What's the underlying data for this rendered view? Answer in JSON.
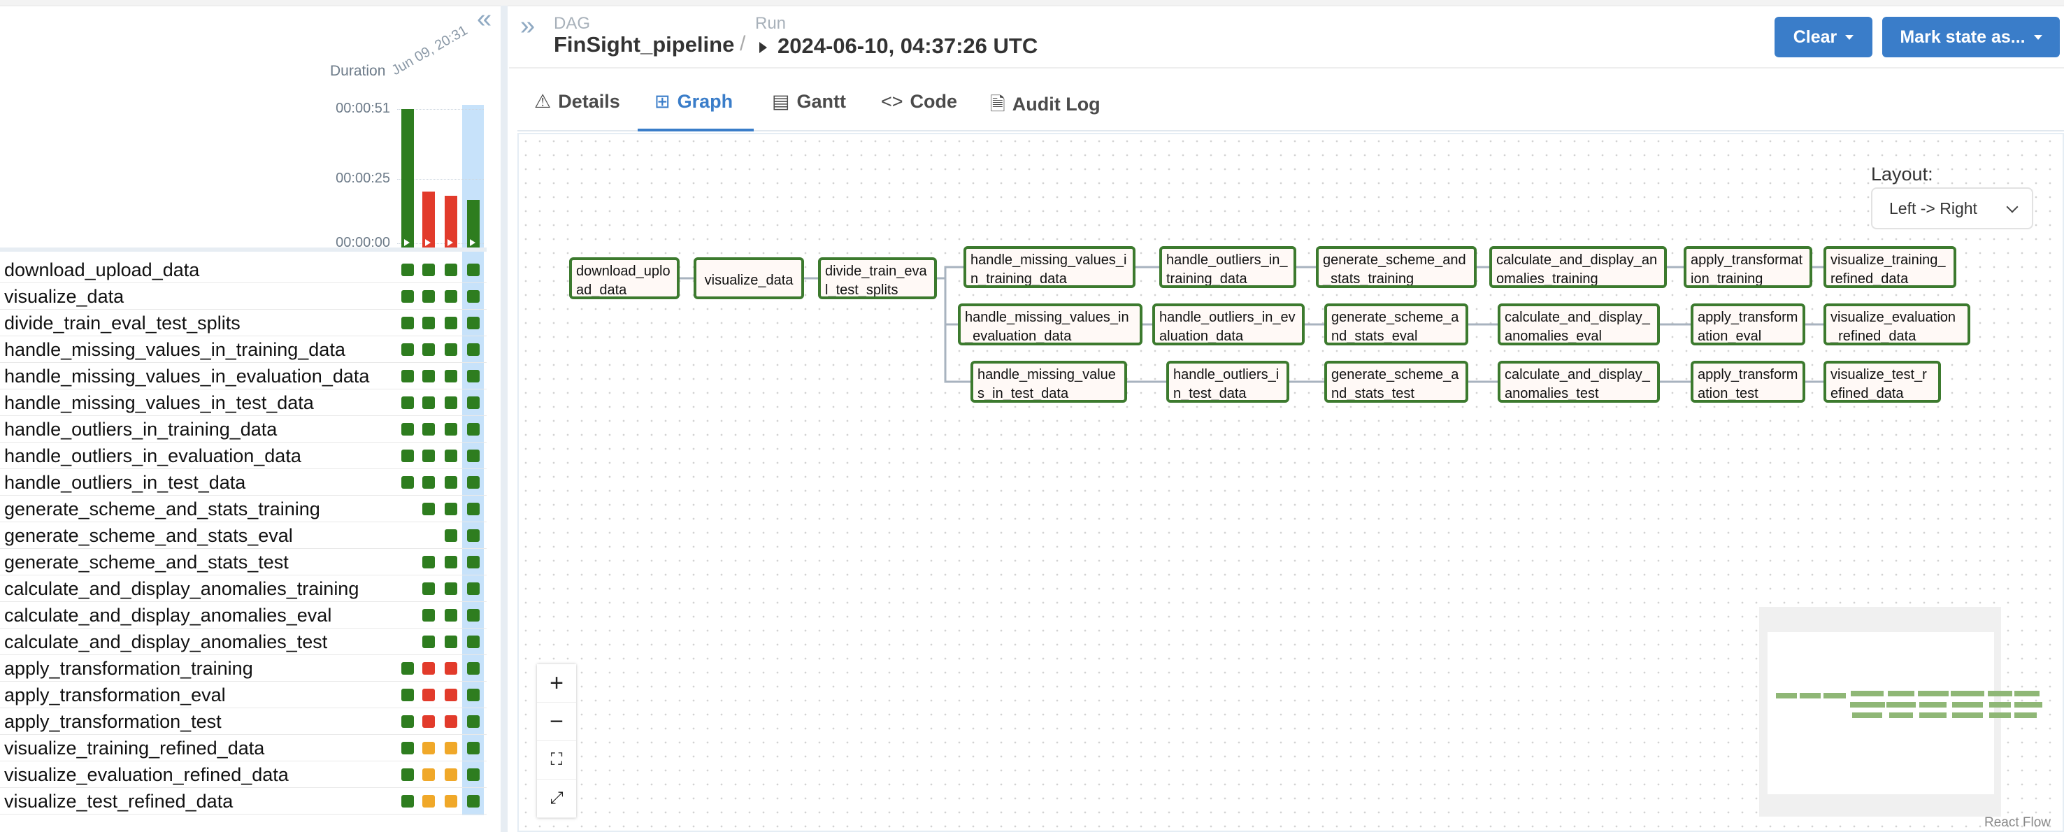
{
  "grid": {
    "collapse_icon": "double-chevron-left-icon",
    "duration_label": "Duration",
    "run_date": "Jun 09, 20:31",
    "y_ticks": [
      "00:00:51",
      "00:00:25",
      "00:00:00"
    ],
    "runs": [
      {
        "duration_fraction": 1.0,
        "color": "#2e7d1f"
      },
      {
        "duration_fraction": 0.41,
        "color": "#e23b2b"
      },
      {
        "duration_fraction": 0.38,
        "color": "#e23b2b"
      },
      {
        "duration_fraction": 0.35,
        "color": "#2e7d1f"
      }
    ],
    "status_colors": {
      "g": "#2e7d1f",
      "r": "#e23b2b",
      "o": "#f0a829",
      "n": ""
    },
    "tasks": [
      {
        "name": "download_upload_data",
        "states": [
          "g",
          "g",
          "g",
          "g"
        ]
      },
      {
        "name": "visualize_data",
        "states": [
          "g",
          "g",
          "g",
          "g"
        ]
      },
      {
        "name": "divide_train_eval_test_splits",
        "states": [
          "g",
          "g",
          "g",
          "g"
        ]
      },
      {
        "name": "handle_missing_values_in_training_data",
        "states": [
          "g",
          "g",
          "g",
          "g"
        ]
      },
      {
        "name": "handle_missing_values_in_evaluation_data",
        "states": [
          "g",
          "g",
          "g",
          "g"
        ]
      },
      {
        "name": "handle_missing_values_in_test_data",
        "states": [
          "g",
          "g",
          "g",
          "g"
        ]
      },
      {
        "name": "handle_outliers_in_training_data",
        "states": [
          "g",
          "g",
          "g",
          "g"
        ]
      },
      {
        "name": "handle_outliers_in_evaluation_data",
        "states": [
          "g",
          "g",
          "g",
          "g"
        ]
      },
      {
        "name": "handle_outliers_in_test_data",
        "states": [
          "g",
          "g",
          "g",
          "g"
        ]
      },
      {
        "name": "generate_scheme_and_stats_training",
        "states": [
          "n",
          "g",
          "g",
          "g"
        ]
      },
      {
        "name": "generate_scheme_and_stats_eval",
        "states": [
          "n",
          "n",
          "g",
          "g"
        ]
      },
      {
        "name": "generate_scheme_and_stats_test",
        "states": [
          "n",
          "g",
          "g",
          "g"
        ]
      },
      {
        "name": "calculate_and_display_anomalies_training",
        "states": [
          "n",
          "g",
          "g",
          "g"
        ]
      },
      {
        "name": "calculate_and_display_anomalies_eval",
        "states": [
          "n",
          "g",
          "g",
          "g"
        ]
      },
      {
        "name": "calculate_and_display_anomalies_test",
        "states": [
          "n",
          "g",
          "g",
          "g"
        ]
      },
      {
        "name": "apply_transformation_training",
        "states": [
          "g",
          "r",
          "r",
          "g"
        ]
      },
      {
        "name": "apply_transformation_eval",
        "states": [
          "g",
          "r",
          "r",
          "g"
        ]
      },
      {
        "name": "apply_transformation_test",
        "states": [
          "g",
          "r",
          "r",
          "g"
        ]
      },
      {
        "name": "visualize_training_refined_data",
        "states": [
          "g",
          "o",
          "o",
          "g"
        ]
      },
      {
        "name": "visualize_evaluation_refined_data",
        "states": [
          "g",
          "o",
          "o",
          "g"
        ]
      },
      {
        "name": "visualize_test_refined_data",
        "states": [
          "g",
          "o",
          "o",
          "g"
        ]
      }
    ]
  },
  "header": {
    "expand_icon": "double-chevron-right-icon",
    "dag_label": "DAG",
    "dag_name": "FinSight_pipeline",
    "separator": "/",
    "run_label": "Run",
    "run_id": "2024-06-10, 04:37:26 UTC",
    "clear_label": "Clear",
    "mark_state_label": "Mark state as..."
  },
  "tabs": [
    {
      "label": "Details",
      "icon": "warning-icon",
      "glyph": "⚠",
      "active": false
    },
    {
      "label": "Graph",
      "icon": "graph-icon",
      "glyph": "⊞",
      "active": true
    },
    {
      "label": "Gantt",
      "icon": "gantt-icon",
      "glyph": "▤",
      "active": false
    },
    {
      "label": "Code",
      "icon": "code-icon",
      "glyph": "<>",
      "active": false
    },
    {
      "label": "Audit Log",
      "icon": "document-icon",
      "glyph": "🗎",
      "active": false
    }
  ],
  "graph": {
    "layout_label": "Layout:",
    "layout_value": "Left -> Right",
    "node_border_color": "#3c7a2e",
    "edge_color": "#a8b3bf",
    "nodes": [
      {
        "id": "download_upload_data",
        "text": "download_upload_data"
      },
      {
        "id": "visualize_data",
        "text": "visualize_data"
      },
      {
        "id": "divide_train_eval_test_splits",
        "text": "divide_train_eval_test_splits"
      },
      {
        "id": "hmv_train",
        "text": "handle_missing_values_in_training_data"
      },
      {
        "id": "ho_train",
        "text": "handle_outliers_in_training_data"
      },
      {
        "id": "gs_train",
        "text": "generate_scheme_and_stats_training"
      },
      {
        "id": "cd_train",
        "text": "calculate_and_display_anomalies_training"
      },
      {
        "id": "at_train",
        "text": "apply_transformation_training"
      },
      {
        "id": "vr_train",
        "text": "visualize_training_refined_data"
      },
      {
        "id": "hmv_eval",
        "text": "handle_missing_values_in_evaluation_data"
      },
      {
        "id": "ho_eval",
        "text": "handle_outliers_in_evaluation_data"
      },
      {
        "id": "gs_eval",
        "text": "generate_scheme_and_stats_eval"
      },
      {
        "id": "cd_eval",
        "text": "calculate_and_display_anomalies_eval"
      },
      {
        "id": "at_eval",
        "text": "apply_transformation_eval"
      },
      {
        "id": "vr_eval",
        "text": "visualize_evaluation_refined_data"
      },
      {
        "id": "hmv_test",
        "text": "handle_missing_values_in_test_data"
      },
      {
        "id": "ho_test",
        "text": "handle_outliers_in_test_data"
      },
      {
        "id": "gs_test",
        "text": "generate_scheme_and_stats_test"
      },
      {
        "id": "cd_test",
        "text": "calculate_and_display_anomalies_test"
      },
      {
        "id": "at_test",
        "text": "apply_transformation_test"
      },
      {
        "id": "vr_test",
        "text": "visualize_test_refined_data"
      }
    ],
    "edges": [
      [
        "download_upload_data",
        "visualize_data"
      ],
      [
        "visualize_data",
        "divide_train_eval_test_splits"
      ],
      [
        "divide_train_eval_test_splits",
        "hmv_train"
      ],
      [
        "divide_train_eval_test_splits",
        "hmv_eval"
      ],
      [
        "divide_train_eval_test_splits",
        "hmv_test"
      ],
      [
        "hmv_train",
        "ho_train"
      ],
      [
        "ho_train",
        "gs_train"
      ],
      [
        "gs_train",
        "cd_train"
      ],
      [
        "cd_train",
        "at_train"
      ],
      [
        "at_train",
        "vr_train"
      ],
      [
        "hmv_eval",
        "ho_eval"
      ],
      [
        "ho_eval",
        "gs_eval"
      ],
      [
        "gs_eval",
        "cd_eval"
      ],
      [
        "cd_eval",
        "at_eval"
      ],
      [
        "at_eval",
        "vr_eval"
      ],
      [
        "hmv_test",
        "ho_test"
      ],
      [
        "ho_test",
        "gs_test"
      ],
      [
        "gs_test",
        "cd_test"
      ],
      [
        "cd_test",
        "at_test"
      ],
      [
        "at_test",
        "vr_test"
      ]
    ],
    "controls": [
      {
        "name": "zoom-in-button",
        "glyph": "+"
      },
      {
        "name": "zoom-out-button",
        "glyph": "−"
      },
      {
        "name": "fit-view-button",
        "glyph": "⛶"
      },
      {
        "name": "fullscreen-button",
        "glyph": "⤢"
      }
    ],
    "attribution": "React Flow"
  }
}
